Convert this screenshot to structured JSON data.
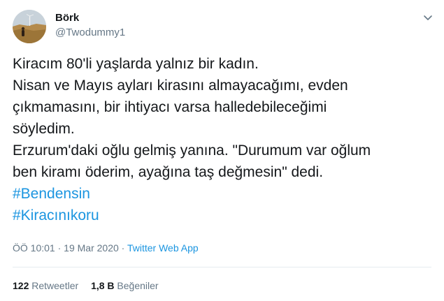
{
  "author": {
    "display_name": "Börk",
    "handle": "@Twodummy1",
    "avatar_icon": "profile-photo-landscape"
  },
  "tweet": {
    "lines": [
      "Kiracım 80'li yaşlarda yalnız bir kadın.",
      "Nisan ve Mayıs ayları kirasını almayacağımı, evden",
      "çıkmamasını, bir  ihtiyacı varsa halledebileceğimi",
      "söyledim.",
      "Erzurum'daki oğlu gelmiş yanına. \"Durumum var oğlum",
      "ben kiramı öderim, ayağına taş değmesin\" dedi."
    ],
    "hashtags": [
      "#Bendensin",
      "#Kiracınıkoru"
    ]
  },
  "meta": {
    "time": "ÖÖ 10:01",
    "separator": "·",
    "date": "19 Mar 2020",
    "source": "Twitter Web App"
  },
  "stats": {
    "retweets_count": "122",
    "retweets_label": "Retweetler",
    "likes_count": "1,8 B",
    "likes_label": "Beğeniler"
  },
  "colors": {
    "link": "#1b95e0",
    "muted": "#657786",
    "text": "#14171a",
    "divider": "#e6ecf0"
  }
}
